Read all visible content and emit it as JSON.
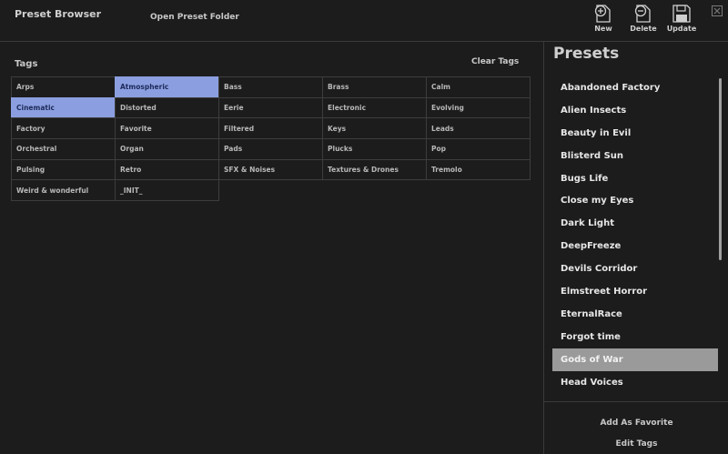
{
  "header": {
    "title": "Preset Browser",
    "open_folder": "Open Preset Folder",
    "tools": [
      {
        "label": "New",
        "icon": "new-document-icon"
      },
      {
        "label": "Delete",
        "icon": "delete-document-icon"
      },
      {
        "label": "Update",
        "icon": "save-disk-icon"
      }
    ],
    "close_icon": "close-icon"
  },
  "tags_panel": {
    "heading": "Tags",
    "clear_label": "Clear Tags",
    "rows": [
      [
        "Arps",
        "Atmospheric",
        "Bass",
        "Brass",
        "Calm"
      ],
      [
        "Cinematic",
        "Distorted",
        "Eerie",
        "Electronic",
        "Evolving"
      ],
      [
        "Factory",
        "Favorite",
        "Filtered",
        "Keys",
        "Leads"
      ],
      [
        "Orchestral",
        "Organ",
        "Pads",
        "Plucks",
        "Pop"
      ],
      [
        "Pulsing",
        "Retro",
        "SFX & Noises",
        "Textures & Drones",
        "Tremolo"
      ],
      [
        "Weird & wonderful",
        "_INIT_"
      ]
    ],
    "selected_tags": [
      "Atmospheric",
      "Cinematic"
    ],
    "selected_color": "#8b9fe0"
  },
  "presets_panel": {
    "title": "Presets",
    "items": [
      "Abandoned Factory",
      "Alien Insects",
      "Beauty in Evil",
      "Blisterd Sun",
      "Bugs Life",
      "Close my Eyes",
      "Dark Light",
      "DeepFreeze",
      "Devils Corridor",
      "Elmstreet Horror",
      "EternalRace",
      "Forgot time",
      "Gods of War",
      "Head Voices"
    ],
    "selected": "Gods of War",
    "add_favorite": "Add As Favorite",
    "edit_tags": "Edit Tags"
  }
}
